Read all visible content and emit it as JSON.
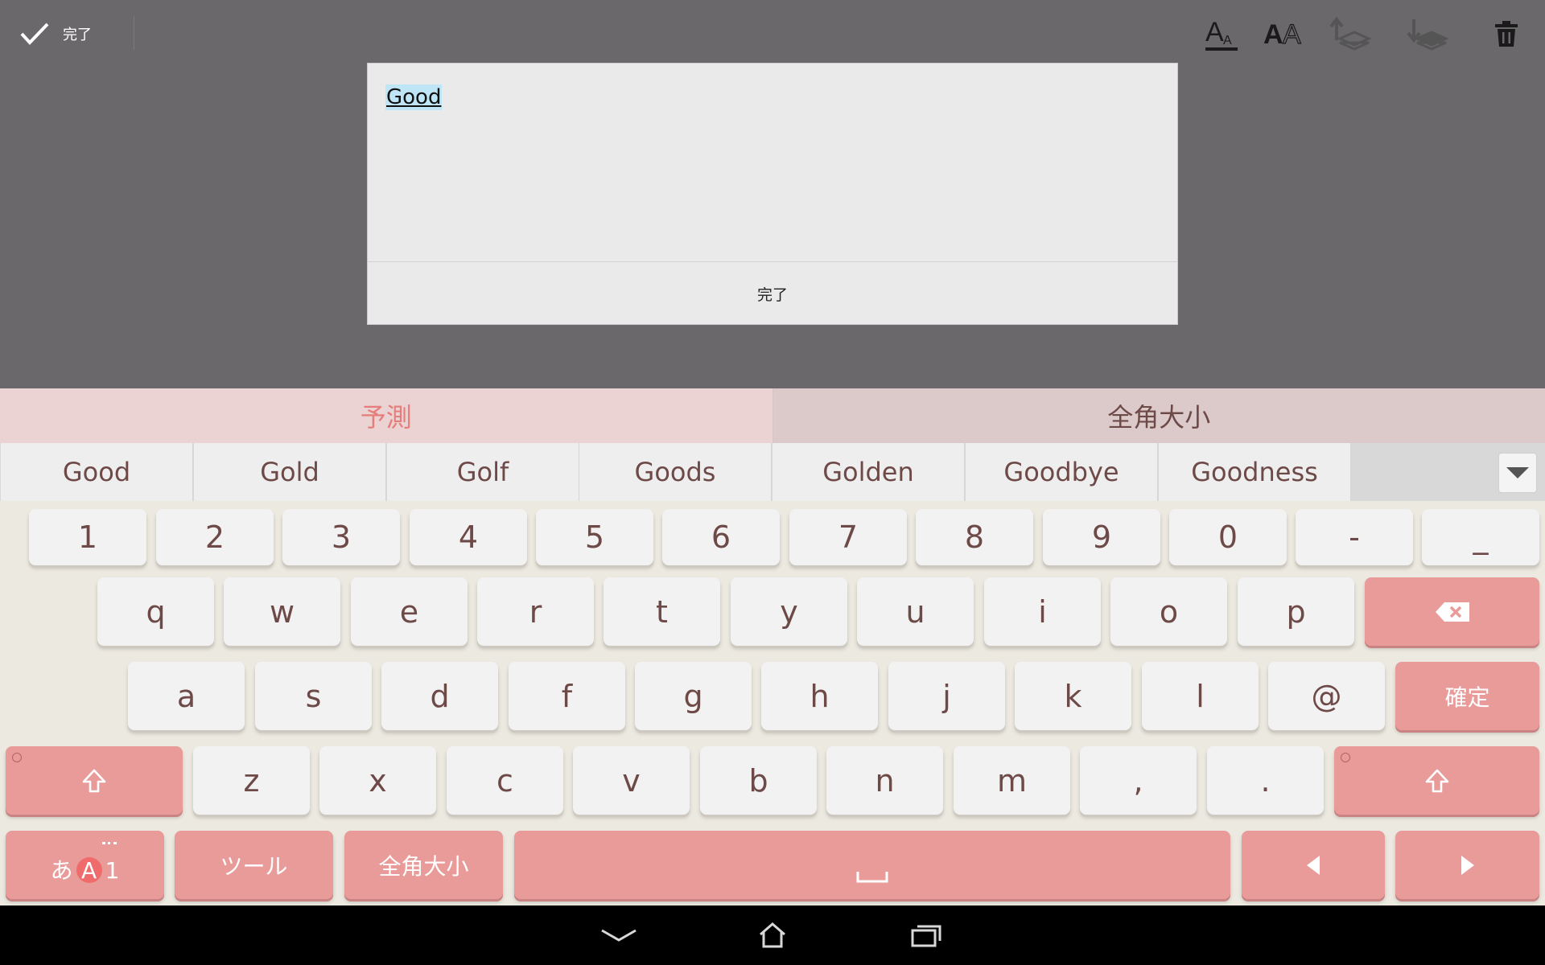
{
  "toolbar": {
    "done_label": "完了",
    "done_icon": "checkmark-icon",
    "tools": [
      {
        "name": "text-size-icon",
        "glyph": "A"
      },
      {
        "name": "font-style-icon",
        "glyph": "AA"
      },
      {
        "name": "bring-forward-icon"
      },
      {
        "name": "send-backward-icon"
      },
      {
        "name": "trash-icon"
      }
    ]
  },
  "dialog": {
    "text_value": "Good",
    "done_label": "完了"
  },
  "keyboard": {
    "tabs": [
      {
        "label": "予測",
        "active": true
      },
      {
        "label": "全角大小",
        "active": false
      }
    ],
    "candidates": [
      "Good",
      "Gold",
      "Golf",
      "Goods",
      "Golden",
      "Goodbye",
      "Goodness"
    ],
    "candidate_expand_icon": "chevron-down-icon",
    "row_numbers": [
      "1",
      "2",
      "3",
      "4",
      "5",
      "6",
      "7",
      "8",
      "9",
      "0",
      "-",
      "_"
    ],
    "row_q": [
      "q",
      "w",
      "e",
      "r",
      "t",
      "y",
      "u",
      "i",
      "o",
      "p"
    ],
    "backspace_icon": "backspace-icon",
    "row_a": [
      "a",
      "s",
      "d",
      "f",
      "g",
      "h",
      "j",
      "k",
      "l",
      "@"
    ],
    "enter_label": "確定",
    "row_z": [
      "z",
      "x",
      "c",
      "v",
      "b",
      "n",
      "m",
      ",",
      "."
    ],
    "shift_icon": "shift-icon",
    "mode_label_kana": "あ",
    "mode_label_alpha": "A",
    "mode_label_num": "1",
    "tool_label": "ツール",
    "width_label": "全角大小",
    "space_icon": "space-icon",
    "left_icon": "arrow-left-icon",
    "right_icon": "arrow-right-icon"
  },
  "navbar": {
    "back_icon": "back-icon",
    "home_icon": "home-icon",
    "recents_icon": "recents-icon"
  },
  "colors": {
    "accent_pink": "#e89b99",
    "key_text": "#6d4a47",
    "tab_active_text": "#e57d7a",
    "selection": "#bfe6f7"
  }
}
